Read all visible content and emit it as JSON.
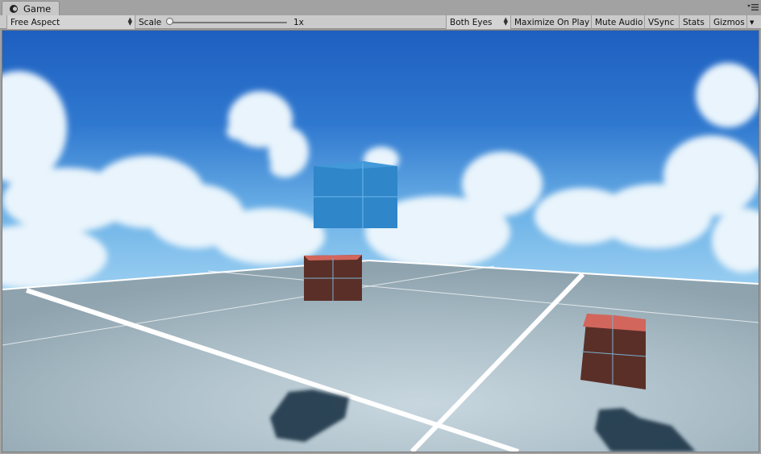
{
  "window": {
    "tab_label": "Game"
  },
  "toolbar": {
    "aspect_label": "Free Aspect",
    "scale_label": "Scale",
    "scale_value": "1x",
    "eyes_label": "Both Eyes",
    "maximize_label": "Maximize On Play",
    "mute_label": "Mute Audio",
    "vsync_label": "VSync",
    "stats_label": "Stats",
    "gizmos_label": "Gizmos"
  },
  "icons": {
    "tab": "game-controller-icon",
    "menu": "panel-menu-icon",
    "aspect_dropdown": "dropdown-arrows-icon",
    "eyes_dropdown": "dropdown-arrows-icon",
    "gizmos_dropdown": "dropdown-triangle-icon"
  },
  "colors": {
    "sky_top": "#1e5fc0",
    "sky_horizon": "#9fd1f2",
    "ground": "#a9bcc6",
    "cube_blue": "#2f86c9",
    "cube_brown": "#5a2f28",
    "cube_top_red": "#d2665c"
  }
}
